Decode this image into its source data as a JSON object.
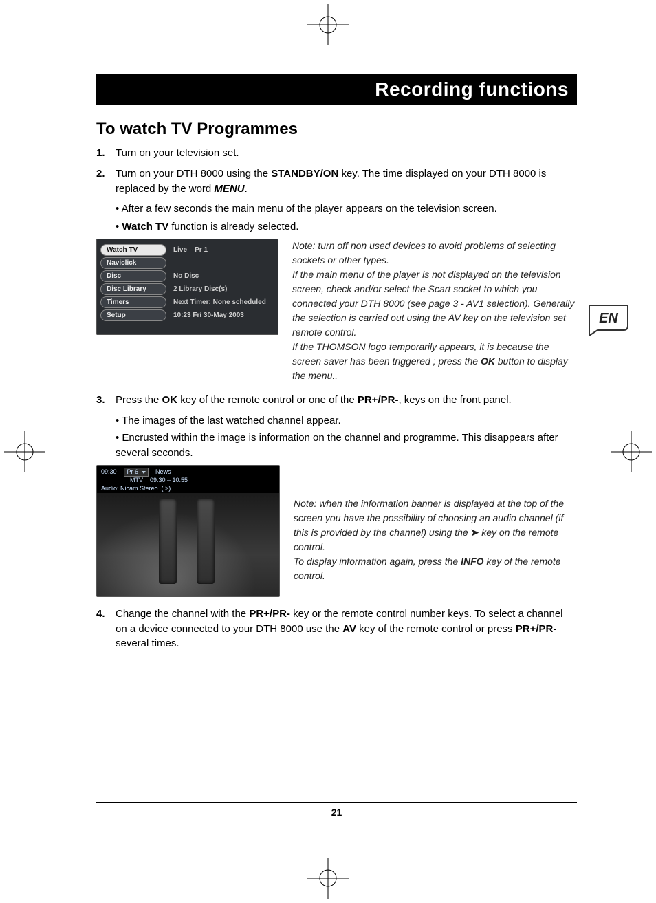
{
  "header": {
    "title": "Recording functions"
  },
  "section_heading": "To watch TV Programmes",
  "lang_badge": "EN",
  "page_number": "21",
  "steps": {
    "s1": {
      "num": "1.",
      "text": "Turn on your television set."
    },
    "s2": {
      "num": "2.",
      "lead": "Turn on your DTH 8000 using the ",
      "key1": "STANDBY/ON",
      "mid": " key. The time displayed on your DTH 8000 is replaced by the word ",
      "menu_word": "MENU",
      "tail": ".",
      "sub1_pre": "• After a few seconds the main menu of the player appears on the television screen.",
      "sub2_pre": "• ",
      "sub2_bold": "Watch TV",
      "sub2_post": " function is already selected."
    },
    "s3": {
      "num": "3.",
      "lead": "Press the ",
      "key1": "OK",
      "mid1": " key of the remote control or one of the ",
      "key2": "PR+/PR-",
      "tail": ", keys on the front panel.",
      "sub1": "• The images of the last watched channel appear.",
      "sub2": "• Encrusted within the image is information on the channel and programme. This disappears after several seconds."
    },
    "s4": {
      "num": "4.",
      "lead": "Change the channel with the ",
      "key1": "PR+/PR-",
      "mid1": " key or the remote control number keys. To select a channel on a device connected to your DTH 8000 use the ",
      "key2": "AV",
      "mid2": " key of the remote control or press ",
      "key3": "PR+/PR-",
      "tail": " several times."
    }
  },
  "menu_shot": {
    "items": [
      {
        "label": "Watch TV",
        "value": "Live – Pr 1",
        "selected": true
      },
      {
        "label": "Naviclick",
        "value": ""
      },
      {
        "label": "Disc",
        "value": "No Disc"
      },
      {
        "label": "Disc Library",
        "value": "2 Library Disc(s)"
      },
      {
        "label": "Timers",
        "value": "Next Timer: None scheduled"
      },
      {
        "label": "Setup",
        "value": "10:23 Fri 30-May 2003"
      }
    ]
  },
  "tv_shot": {
    "time": "09:30",
    "pr": "Pr 6",
    "title": "News",
    "channel": "MTV",
    "range": "09:30 – 10:55",
    "audio": "Audio: Nicam Stereo. ( >)"
  },
  "note1": {
    "p1": "Note: turn off non used devices to avoid problems of selecting sockets or other types.",
    "p2": "If the main menu of the player is not displayed on the television screen, check and/or select the Scart socket to which you connected your DTH 8000 (see page 3 - AV1 selection). Generally the selection is carried out using the AV key on the television set remote control.",
    "p3_a": "If the THOMSON logo temporarily appears, it is because the screen saver has been triggered ; press the ",
    "p3_key": "OK",
    "p3_b": " button to display the menu.."
  },
  "note2": {
    "p1_a": "Note: when the information banner is displayed at the top of the screen you have the possibility of choosing an audio channel (if this is provided by the channel) using the ",
    "arrow": "➤",
    "p1_b": " key on the remote control.",
    "p2_a": "To display information again, press the ",
    "p2_key": "INFO",
    "p2_b": " key of the remote control."
  }
}
